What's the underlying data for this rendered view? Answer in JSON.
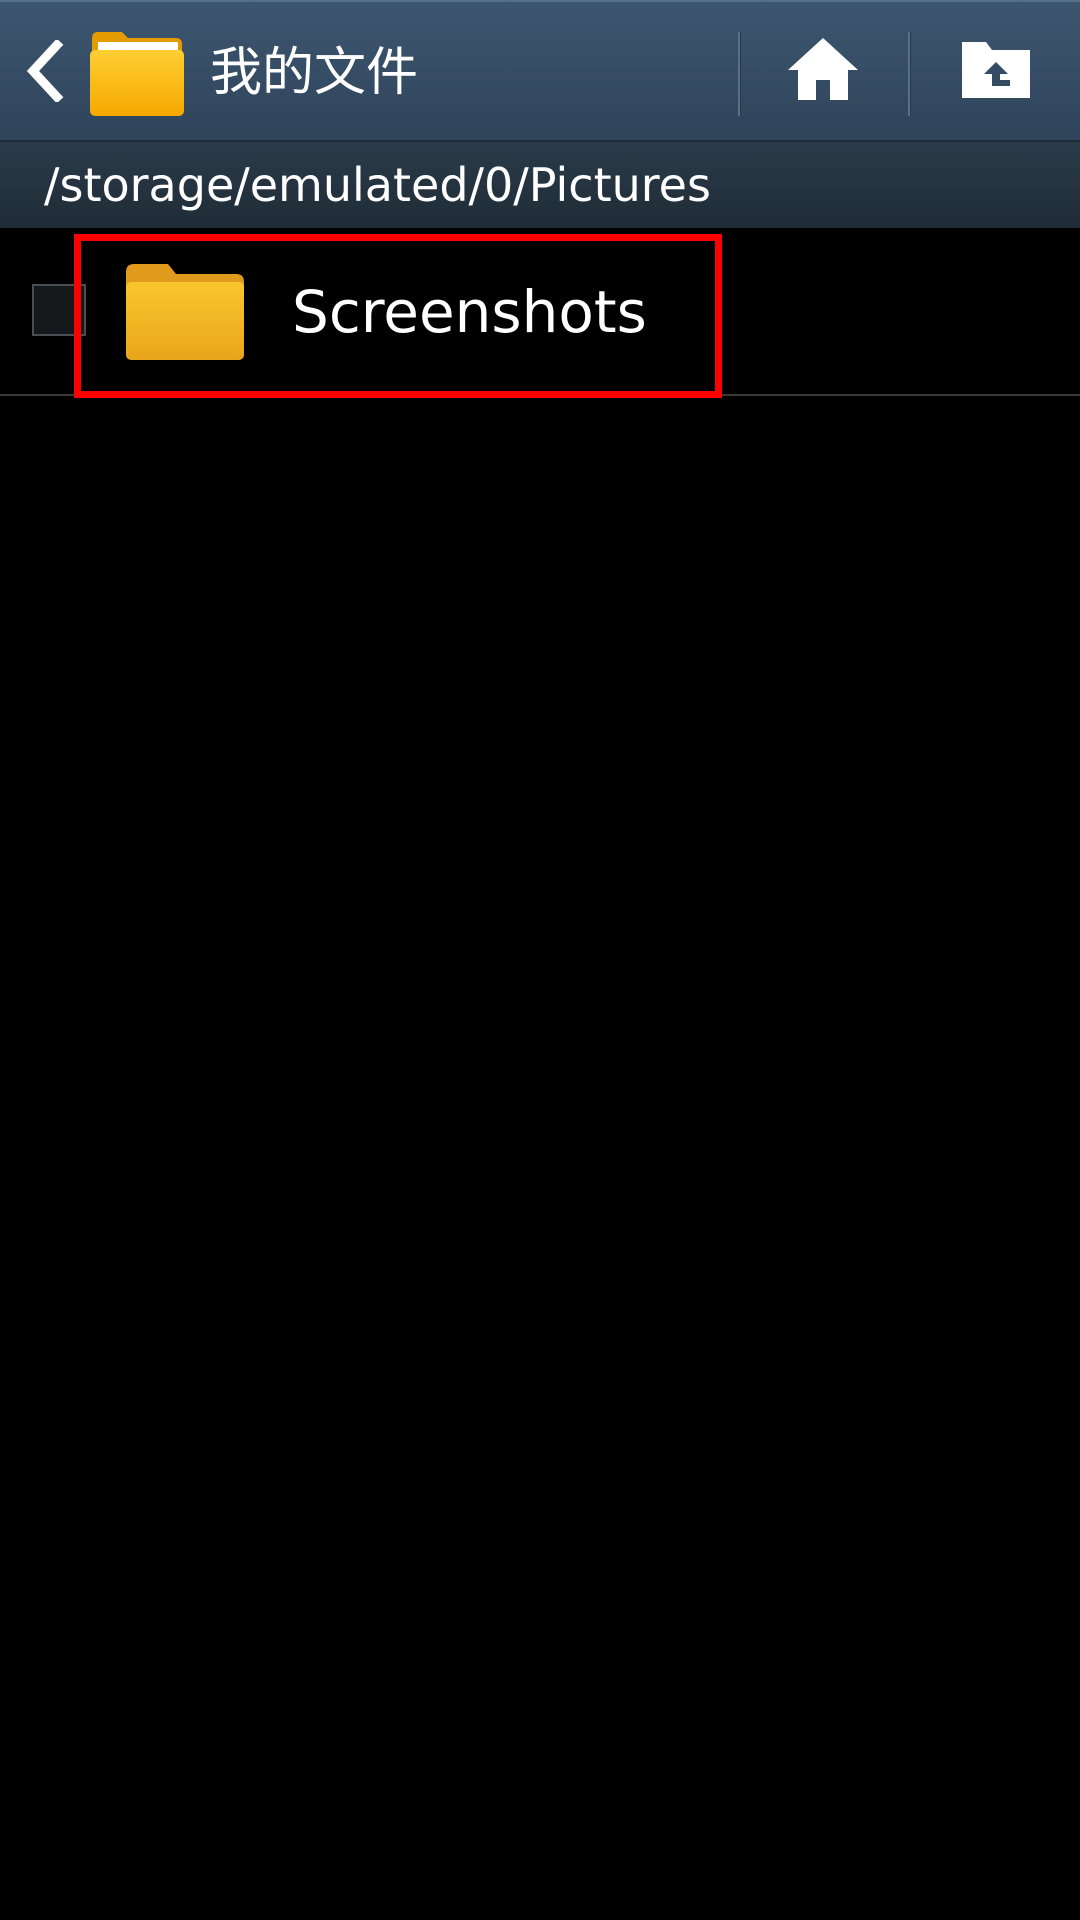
{
  "action_bar": {
    "title": "我的文件",
    "back_icon": "chevron-left-icon",
    "app_icon": "folder-icon",
    "home_icon": "home-icon",
    "up_icon": "folder-up-icon"
  },
  "path_bar": {
    "path": "/storage/emulated/0/Pictures"
  },
  "file_list": {
    "items": [
      {
        "label": "Screenshots",
        "type": "folder",
        "checked": false
      }
    ]
  },
  "colors": {
    "action_bar": "#344b63",
    "path_bar": "#25333f",
    "background": "#000000",
    "folder": "#f5b800",
    "highlight": "#ff0000"
  }
}
